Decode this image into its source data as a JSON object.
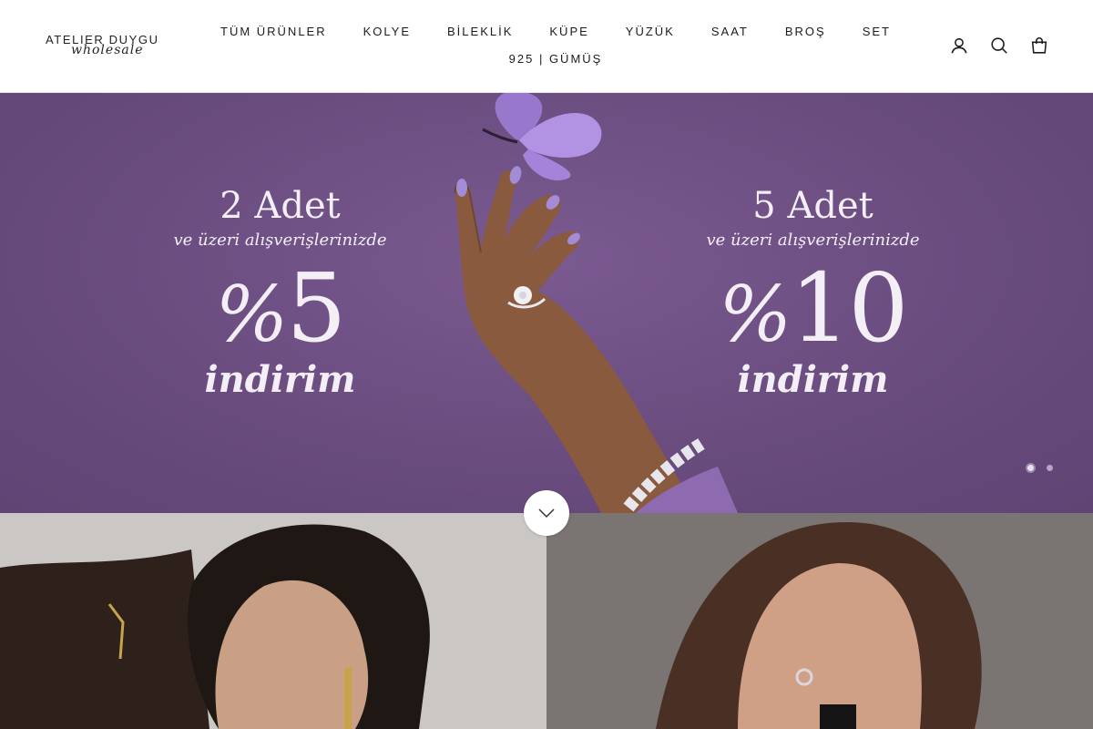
{
  "brand": {
    "name": "ATELIER DUYGU",
    "tagline": "wholesale"
  },
  "nav": {
    "row1": [
      "TÜM ÜRÜNLER",
      "KOLYE",
      "BİLEKLİK",
      "KÜPE",
      "YÜZÜK",
      "SAAT",
      "BROŞ",
      "SET"
    ],
    "row2": [
      "925 | GÜMÜŞ"
    ]
  },
  "header_icons": [
    "account-icon",
    "search-icon",
    "cart-icon"
  ],
  "hero": {
    "offers": [
      {
        "qty": "2 Adet",
        "sub": "ve üzeri alışverişlerinizde",
        "pct_sign": "%",
        "pct": "5",
        "word": "indirim"
      },
      {
        "qty": "5 Adet",
        "sub": "ve üzeri alışverişlerinizde",
        "pct_sign": "%",
        "pct": "10",
        "word": "indirim"
      }
    ],
    "slides": 2,
    "active_slide": 1,
    "bg_color": "#6c4e81"
  }
}
